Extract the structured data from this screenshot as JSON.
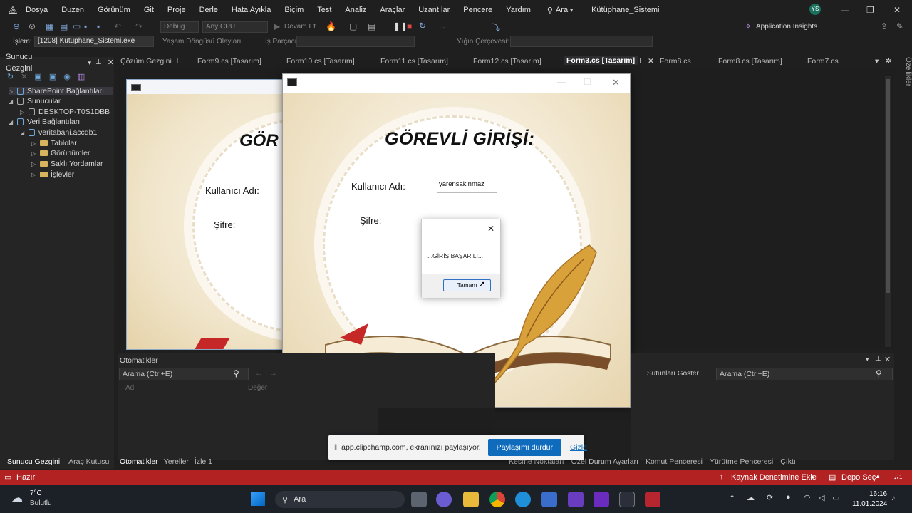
{
  "titlebar": {
    "menu": [
      "Dosya",
      "Duzen",
      "Görünüm",
      "Git",
      "Proje",
      "Derle",
      "Hata Ayıkla",
      "Biçim",
      "Test",
      "Analiz",
      "Araçlar",
      "Uzantılar",
      "Pencere",
      "Yardım"
    ],
    "search": "Ara",
    "solution": "Kütüphane_Sistemi",
    "avatar": "YS"
  },
  "toolbar": {
    "config": "Debug",
    "platform": "Any CPU",
    "continue": "Devam Et",
    "app_insights": "Application Insights",
    "process_label": "İşlem:",
    "process_value": "[1208] Kütüphane_Sistemi.exe",
    "lifecycle": "Yaşam Döngüsü Olayları",
    "thread_label": "İş Parçacığı:",
    "stack_label": "Yığın Çerçevesi:"
  },
  "left_panel": {
    "title": "Sunucu Gezgini",
    "items": [
      {
        "label": "SharePoint Bağlantıları",
        "level": 0,
        "arrow": "▷"
      },
      {
        "label": "Sunucular",
        "level": 0,
        "arrow": "◢"
      },
      {
        "label": "DESKTOP-T0S1DBB",
        "level": 1,
        "arrow": "▷"
      },
      {
        "label": "Veri Bağlantıları",
        "level": 0,
        "arrow": "◢"
      },
      {
        "label": "veritabani.accdb1",
        "level": 1,
        "arrow": "◢"
      },
      {
        "label": "Tablolar",
        "level": 2,
        "arrow": "▷"
      },
      {
        "label": "Görünümler",
        "level": 2,
        "arrow": "▷"
      },
      {
        "label": "Saklı Yordamlar",
        "level": 2,
        "arrow": "▷"
      },
      {
        "label": "İşlevler",
        "level": 2,
        "arrow": "▷"
      }
    ],
    "bottom_tabs": [
      "Sunucu Gezgini",
      "Araç Kutusu"
    ]
  },
  "doc_tabs": [
    {
      "label": "Çözüm Gezgini",
      "active": false
    },
    {
      "label": "Form9.cs [Tasarım]",
      "active": false
    },
    {
      "label": "Form10.cs [Tasarım]",
      "active": false
    },
    {
      "label": "Form11.cs [Tasarım]",
      "active": false
    },
    {
      "label": "Form12.cs [Tasarım]",
      "active": false
    },
    {
      "label": "Form3.cs [Tasarım]",
      "active": true
    },
    {
      "label": "Form8.cs",
      "active": false
    },
    {
      "label": "Form8.cs [Tasarım]",
      "active": false
    },
    {
      "label": "Form7.cs",
      "active": false
    }
  ],
  "right_rail": "Özellikler",
  "design_form": {
    "title_partial": "GÖR",
    "username_label": "Kullanıcı Adı:",
    "password_label": "Şifre:"
  },
  "running_form": {
    "title": "GÖREVLİ GİRİŞİ:",
    "username_label": "Kullanıcı Adı:",
    "username_value": "yarensakinmaz",
    "password_label": "Şifre:"
  },
  "message_box": {
    "text": "...GİRİŞ BAŞARILI...",
    "ok": "Tamam"
  },
  "autos_panel": {
    "title": "Otomatikler",
    "search": "Arama (Ctrl+E)",
    "col_name": "Ad",
    "col_value": "Değer",
    "bottom_tabs": [
      "Otomatikler",
      "Yereller",
      "İzle 1"
    ]
  },
  "right_panel": {
    "show_columns": "Sütunları Göster",
    "search": "Arama (Ctrl+E)",
    "bottom_tabs": [
      "Kesme Noktaları",
      "Özel Durum Ayarları",
      "Komut Penceresi",
      "Yürütme Penceresi",
      "Çıktı"
    ]
  },
  "share_bar": {
    "text": "app.clipchamp.com, ekranınızı paylaşıyor.",
    "stop": "Paylaşımı durdur",
    "hide": "Gizle"
  },
  "statusbar": {
    "ready": "Hazır",
    "source_control": "Kaynak Denetimine Ekle",
    "repo": "Depo Seç",
    "notifications": "1"
  },
  "taskbar": {
    "weather_temp": "7°C",
    "weather_desc": "Bulutlu",
    "search": "Ara",
    "time": "16:16",
    "date": "11.01.2024"
  },
  "colors": {
    "statusbar": "#b22222",
    "share_stop": "#0f6cbd",
    "accent_tab": "#5a5acb"
  }
}
